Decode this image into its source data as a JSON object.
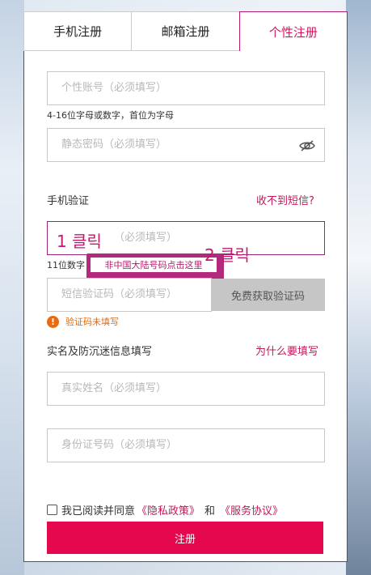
{
  "tabs": [
    {
      "label": "手机注册"
    },
    {
      "label": "邮箱注册"
    },
    {
      "label": "个性注册"
    }
  ],
  "account": {
    "placeholder": "个性账号（必须填写）",
    "hint": "4-16位字母或数字，首位为字母"
  },
  "password": {
    "placeholder": "静态密码（必须填写）"
  },
  "phone_section": {
    "label": "手机验证",
    "link": "收不到短信?"
  },
  "phone_input": {
    "placeholder": "（必须填写）",
    "hint": "11位数字"
  },
  "tooltip": {
    "text": "非中国大陆号码点击这里"
  },
  "annotations": {
    "step1": "1 클릭",
    "step2": "2 클릭"
  },
  "sms_code": {
    "placeholder": "短信验证码（必须填写）",
    "button": "免费获取验证码"
  },
  "error": {
    "icon": "!",
    "text": "验证码未填写"
  },
  "realname": {
    "label": "实名及防沉迷信息填写",
    "link": "为什么要填写"
  },
  "name_input": {
    "placeholder": "真实姓名（必须填写）"
  },
  "id_input": {
    "placeholder": "身份证号码（必须填写）"
  },
  "agreement": {
    "text": "我已阅读并同意",
    "privacy": "《隐私政策》",
    "and": "和",
    "terms": "《服务协议》"
  },
  "submit": {
    "label": "注册"
  },
  "colors": {
    "accent": "#e5084e",
    "link": "#c2185b",
    "error": "#e86b12",
    "tooltip": "#b32a7d"
  }
}
